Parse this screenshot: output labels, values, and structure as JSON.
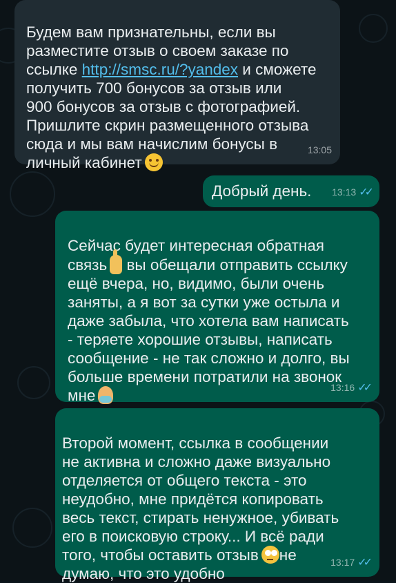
{
  "messages": [
    {
      "direction": "incoming",
      "text_before_link": "Будем вам признательны, если вы\nразместите отзыв о своем заказе по\nссылке ",
      "link": "http://smsc.ru/?yandex",
      "text_after_link": " и сможете\nполучить 700 бонусов за отзыв или\n900 бонусов за отзыв с фотографией.\nПришлите скрин размещенного отзыва\nсюда и мы вам начислим бонусы в\nличный кабинет",
      "emoji": "smiling-face-icon",
      "time": "13:05"
    },
    {
      "direction": "outgoing",
      "text": "Добрый день.",
      "time": "13:13",
      "status": "read"
    },
    {
      "direction": "outgoing",
      "text_part1": "Сейчас будет интересная обратная\nсвязь",
      "emoji1": "pointing-up-icon",
      "text_part2": " вы обещали отправить ссылку\nещё вчера, но, видимо, были очень\nзаняты, а я вот за сутки уже остыла и\nдаже забыла, что хотела вам написать\n- теряете хорошие отзывы, написать\nсообщение - не так сложно и долго, вы\nбольше времени потратили на звонок\nмне",
      "emoji2": "shrug-icon",
      "time": "13:16",
      "status": "read"
    },
    {
      "direction": "outgoing",
      "text_part1": "Второй момент, ссылка в сообщении\nне активна и сложно даже визуально\nотделяется от общего текста - это\nнеудобно, мне придётся копировать\nвесь текст, стирать ненужное, убивать\nего в поисковую строку... И всё ради\nтого, чтобы оставить отзыв",
      "emoji1": "rolling-eyes-icon",
      "text_part2": "не\nдумаю, что это удобно",
      "time": "13:17",
      "status": "read"
    }
  ],
  "colors": {
    "incoming_bubble": "#202c33",
    "outgoing_bubble": "#005c4b",
    "read_ticks": "#53bdeb",
    "background": "#0b141a"
  },
  "ticks_glyph": "✓✓"
}
